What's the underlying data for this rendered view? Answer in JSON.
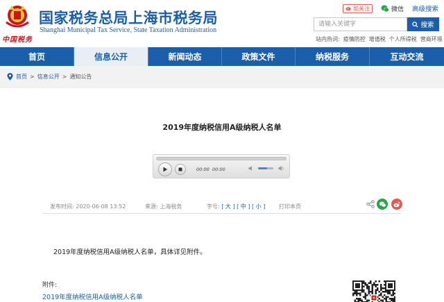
{
  "header": {
    "title_cn": "国家税务总局上海市税务局",
    "title_en": "Shanghai Municipal Tax Service, State Taxation Administration",
    "emblem_text": "中国税务",
    "weibo_label": "加关注",
    "weixin_label": "微信",
    "advanced_search": "高级搜索",
    "search_placeholder": "请输入关键字",
    "search_button": "搜索",
    "hot_label": "站内热词:",
    "hot_words": [
      "疫情防控",
      "增值税",
      "个人所得税",
      "营商环境"
    ]
  },
  "nav": {
    "items": [
      "首页",
      "信息公开",
      "新闻动态",
      "政策文件",
      "纳税服务",
      "互动交流"
    ],
    "active_index": 1
  },
  "breadcrumb": {
    "items": [
      "首页",
      "信息公开",
      "通知公告"
    ],
    "separator": ">"
  },
  "article": {
    "title": "2019年度纳税信用A级纳税人名单",
    "player": {
      "current_time": "00:00",
      "duration": "00:00",
      "volume": 0.6
    },
    "meta": {
      "publish_label": "发布时间:",
      "publish_time": "2020-06-08 13:52",
      "source_label": "来源:",
      "source": "上海税务",
      "font_label": "字号:",
      "font_sizes": [
        "大",
        "中",
        "小"
      ],
      "print_label": "打印本页"
    },
    "body": "2019年度纳税信用A级纳税人名单，具体详见附件。",
    "attachment_label": "附件:",
    "attachment_link": "2019年度纳税信用A级纳税人名单"
  },
  "colors": {
    "brand_blue": "#1b5fab",
    "nav_active_bg": "#e9eef5",
    "weibo_red": "#e05a4f",
    "wechat_green": "#2ba245"
  }
}
